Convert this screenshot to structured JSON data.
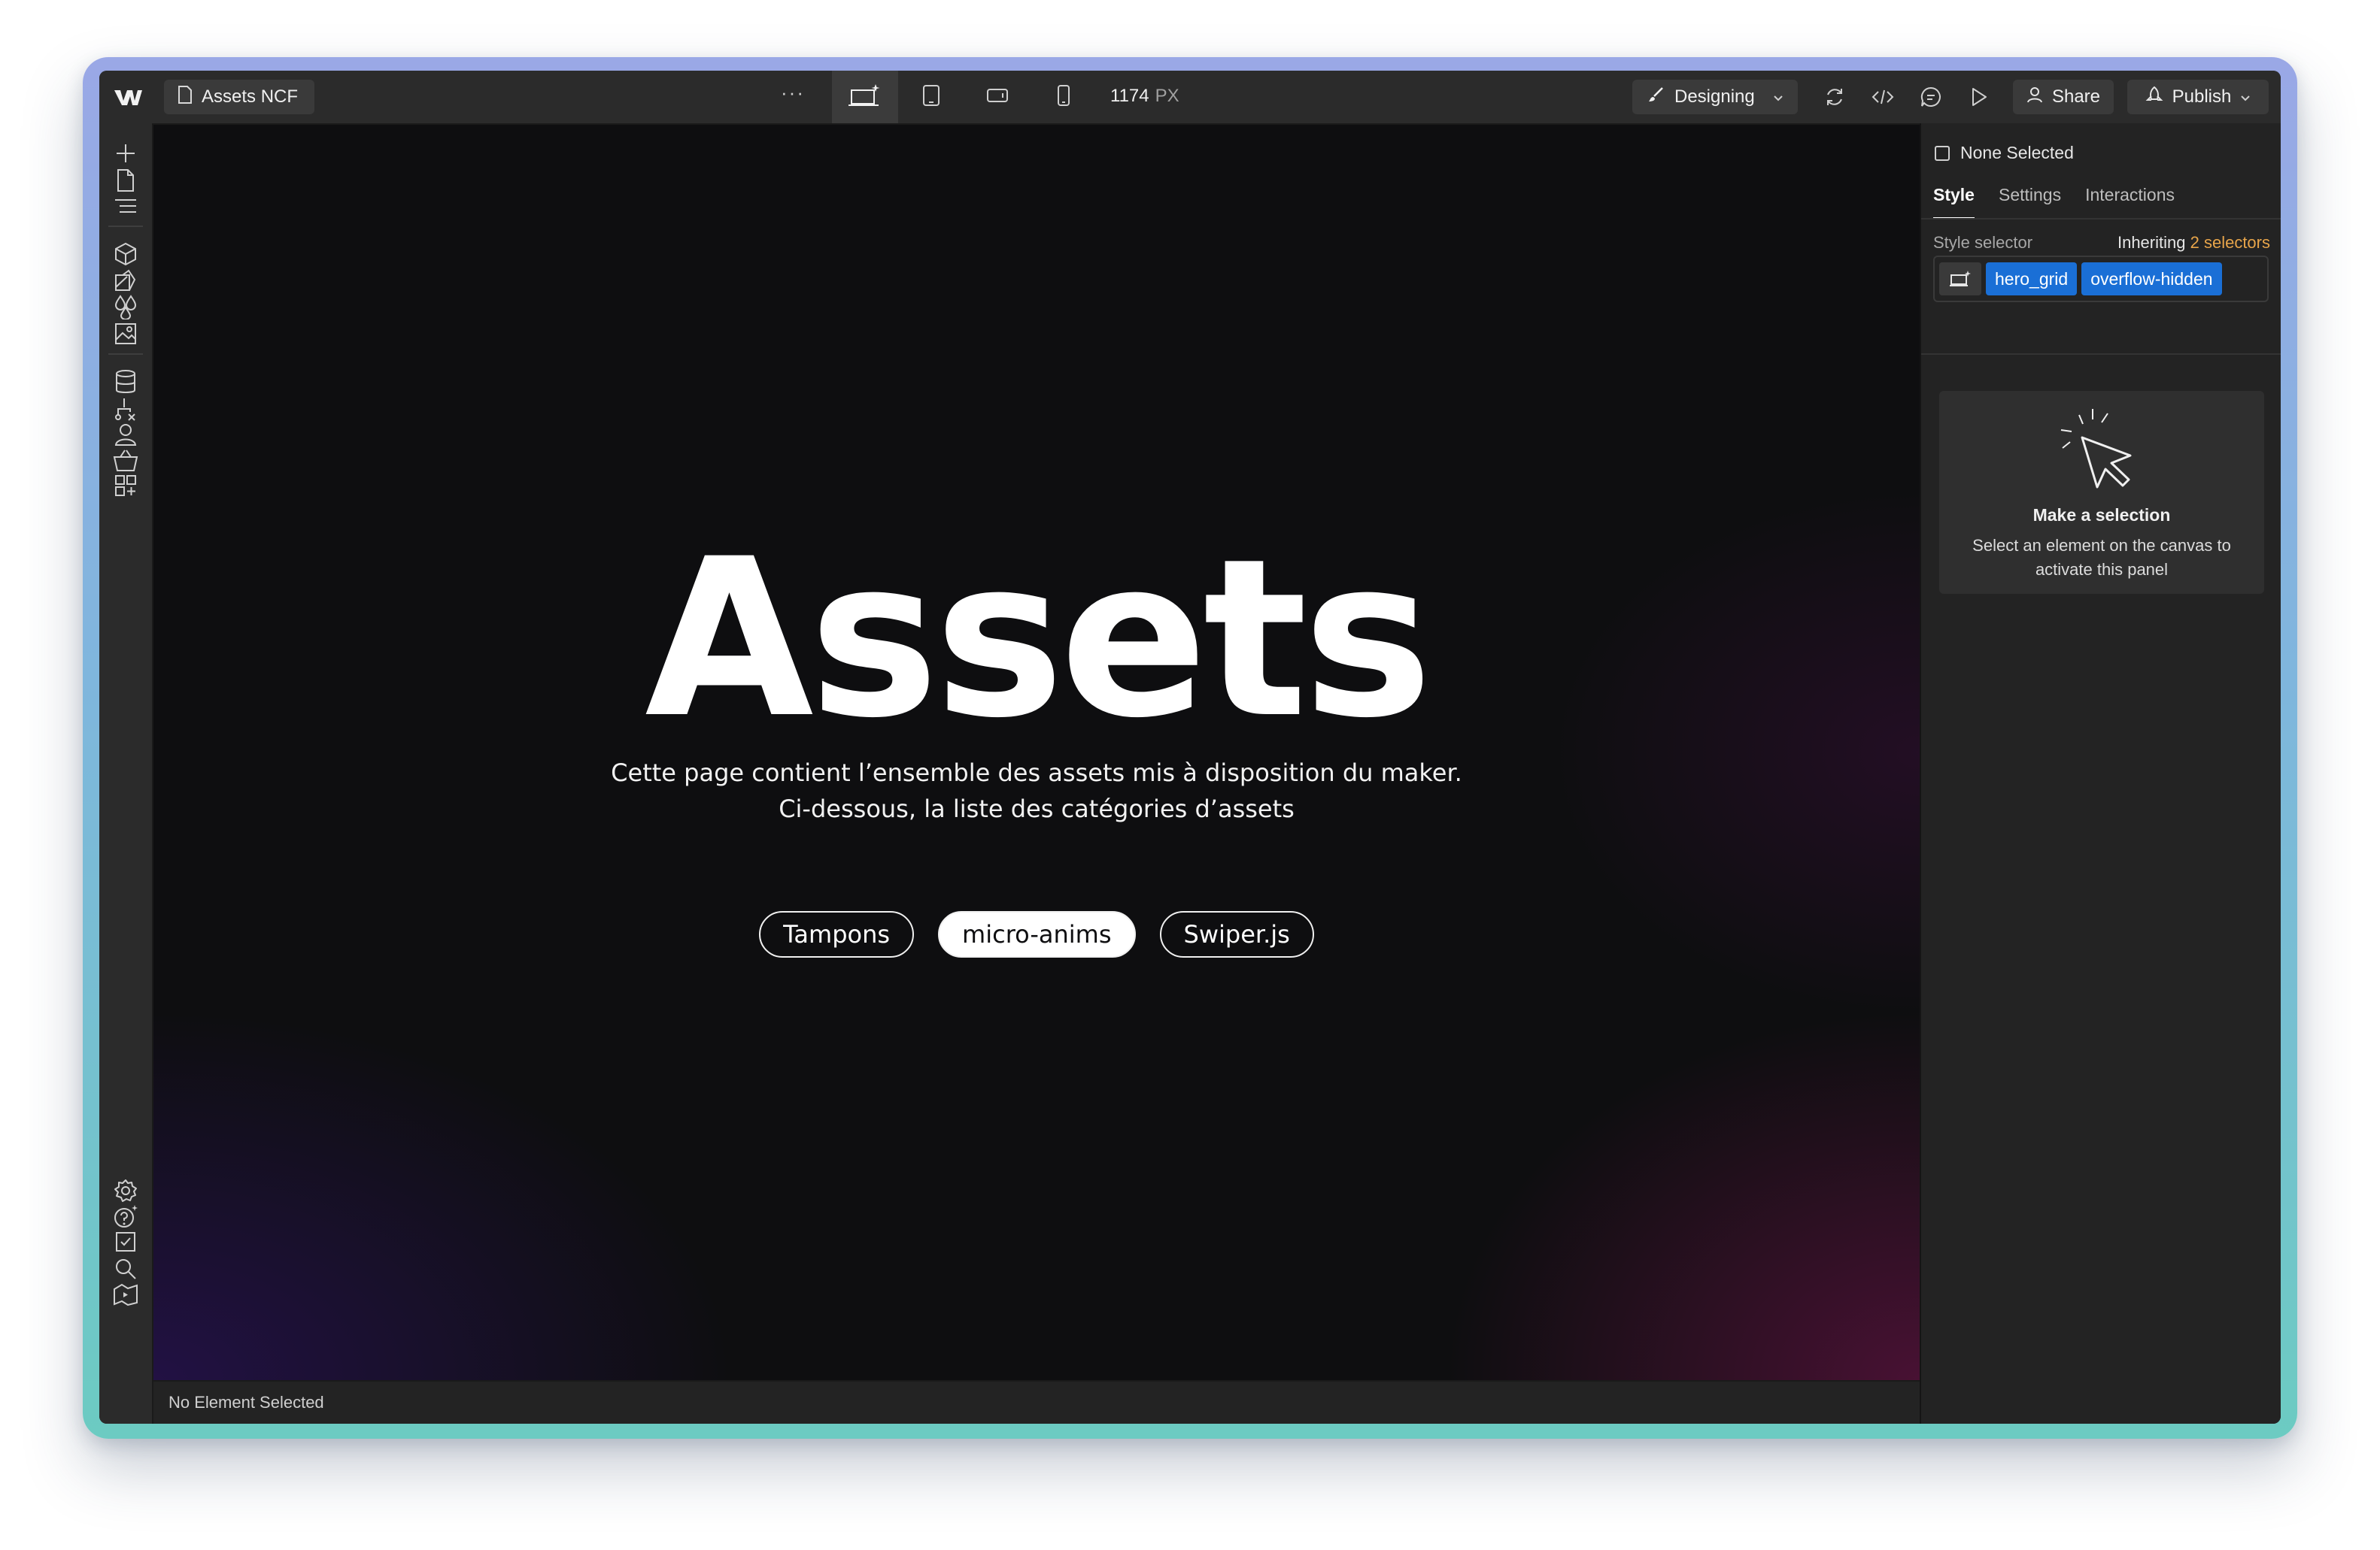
{
  "app": {
    "page_name": "Assets NCF",
    "more_glyph": "···",
    "width_value": "1174",
    "width_unit": "PX",
    "mode_label": "Designing",
    "share_label": "Share",
    "publish_label": "Publish"
  },
  "breakpoints": [
    {
      "icon": "desktop-base-breakpoint-icon",
      "active": true
    },
    {
      "icon": "tablet-breakpoint-icon",
      "active": false
    },
    {
      "icon": "mobile-landscape-breakpoint-icon",
      "active": false
    },
    {
      "icon": "mobile-portrait-breakpoint-icon",
      "active": false
    }
  ],
  "left_sidebar_icons": [
    "add-elements-icon",
    "pages-icon",
    "navigator-icon",
    "components-icon",
    "style-selectors-icon",
    "variables-icon",
    "assets-icon",
    "cms-icon",
    "logic-icon",
    "users-icon",
    "ecommerce-icon",
    "apps-icon",
    "settings-icon",
    "help-icon",
    "audit-icon",
    "search-icon",
    "video-tutorials-icon"
  ],
  "canvas": {
    "title": "Assets",
    "subtitle_line1": "Cette page contient l’ensemble des assets mis à disposition du maker.",
    "subtitle_line2": "Ci-dessous, la liste des catégories d’assets",
    "pills": [
      "Tampons",
      "micro-anims",
      "Swiper.js"
    ]
  },
  "status_bar": {
    "text": "No Element Selected"
  },
  "right_panel": {
    "selection_label": "None Selected",
    "tabs": [
      "Style",
      "Settings",
      "Interactions"
    ],
    "active_tab": "Style",
    "style_selector_label": "Style selector",
    "inheriting_label": "Inheriting",
    "inheriting_count": "2 selectors",
    "tags": [
      "hero_grid",
      "overflow-hidden"
    ],
    "empty_title": "Make a selection",
    "empty_body": "Select an element on the canvas to activate this panel"
  },
  "colors": {
    "tag_blue": "#1a6fd6",
    "inherit_orange": "#e8a54a",
    "canvas_bg": "#0e0e10"
  }
}
